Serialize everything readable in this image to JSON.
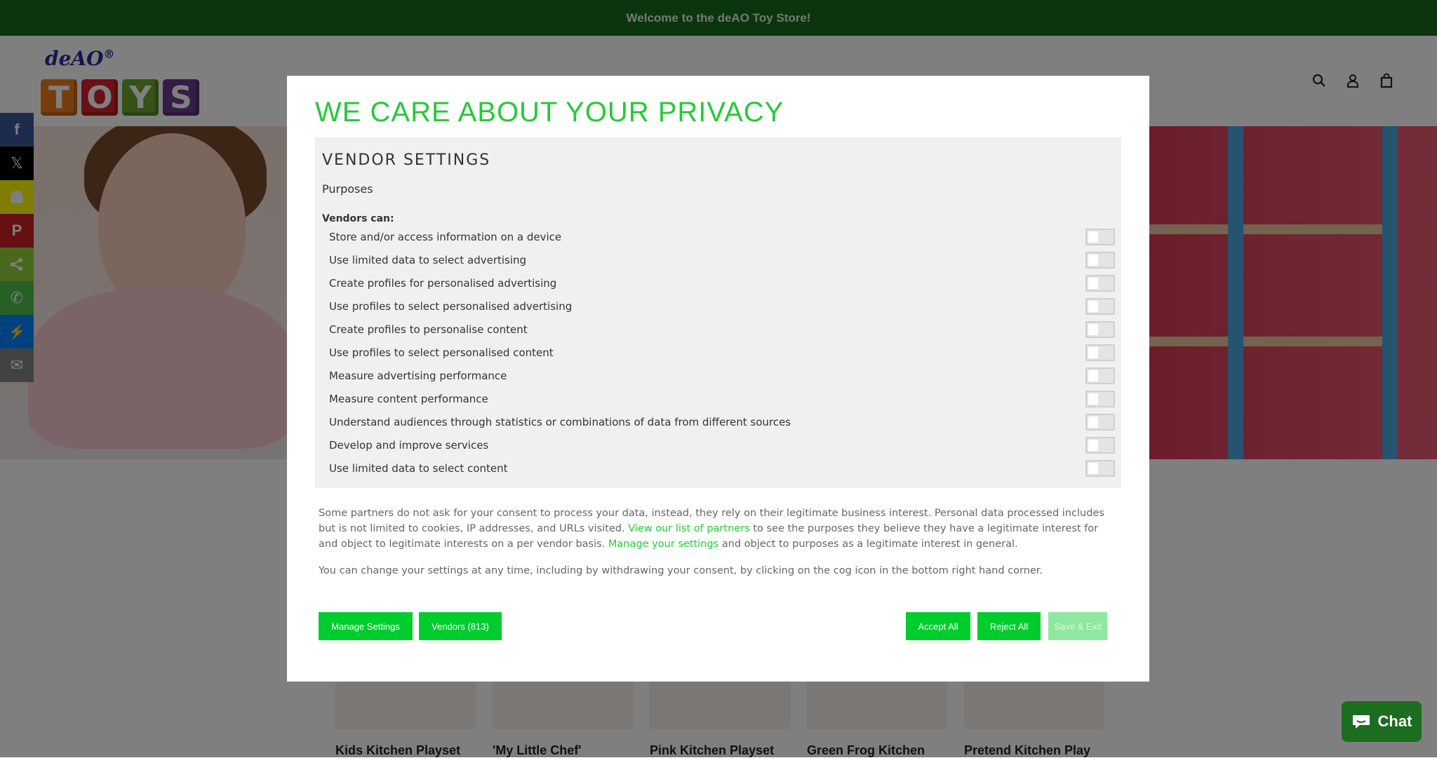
{
  "topbar": {
    "text": "Welcome to the deAO Toy Store!"
  },
  "logo": {
    "top_text": "deAO",
    "reg": "®",
    "letters": [
      "T",
      "O",
      "Y",
      "S"
    ],
    "colors": [
      "#ef7d1a",
      "#d6232a",
      "#6aa52f",
      "#6b3b8c"
    ]
  },
  "header_icons": [
    "search-icon",
    "account-icon",
    "cart-icon"
  ],
  "share_sidebar": [
    {
      "name": "facebook-icon",
      "glyph": "f",
      "color": "#3b5998"
    },
    {
      "name": "x-icon",
      "glyph": "𝕏",
      "color": "#000000"
    },
    {
      "name": "snapchat-icon",
      "glyph": "👻",
      "color": "#fffc00"
    },
    {
      "name": "pinterest-icon",
      "glyph": "P",
      "color": "#cb2027"
    },
    {
      "name": "share-icon",
      "glyph": "<",
      "color": "#95d03a"
    },
    {
      "name": "whatsapp-icon",
      "glyph": "✆",
      "color": "#4dc247"
    },
    {
      "name": "messenger-icon",
      "glyph": "⚡",
      "color": "#0084ff"
    },
    {
      "name": "email-icon",
      "glyph": "✉",
      "color": "#848484"
    }
  ],
  "products": [
    "Kids Kitchen Playset",
    "'My Little Chef'",
    "Pink Kitchen Playset",
    "Green Frog Kitchen",
    "Pretend Kitchen Play"
  ],
  "chat": {
    "label": "Chat"
  },
  "modal": {
    "title": "WE CARE ABOUT YOUR PRIVACY",
    "section_title": "VENDOR SETTINGS",
    "purposes_title": "Purposes",
    "vendors_can": "Vendors can:",
    "purposes": [
      "Store and/or access information on a device",
      "Use limited data to select advertising",
      "Create profiles for personalised advertising",
      "Use profiles to select personalised advertising",
      "Create profiles to personalise content",
      "Use profiles to select personalised content",
      "Measure advertising performance",
      "Measure content performance",
      "Understand audiences through statistics or combinations of data from different sources",
      "Develop and improve services",
      "Use limited data to select content"
    ],
    "info_part1": "Some partners do not ask for your consent to process your data, instead, they rely on their legitimate business interest. Personal data processed includes but is not limited to cookies, IP addresses, and URLs visited. ",
    "info_link1": "View our list of partners",
    "info_part2": " to see the purposes they believe they have a legitimate interest for and object to legitimate interests on a per vendor basis. ",
    "info_link2": "Manage your settings",
    "info_part3": " and object to purposes as a legitimate interest in general.",
    "change_text": "You can change your settings at any time, including by withdrawing your consent, by clicking on the cog icon in the bottom right hand corner.",
    "buttons": {
      "manage": "Manage Settings",
      "vendors": "Vendors (813)",
      "accept": "Accept All",
      "reject": "Reject All",
      "save": "Save & Exit"
    }
  }
}
